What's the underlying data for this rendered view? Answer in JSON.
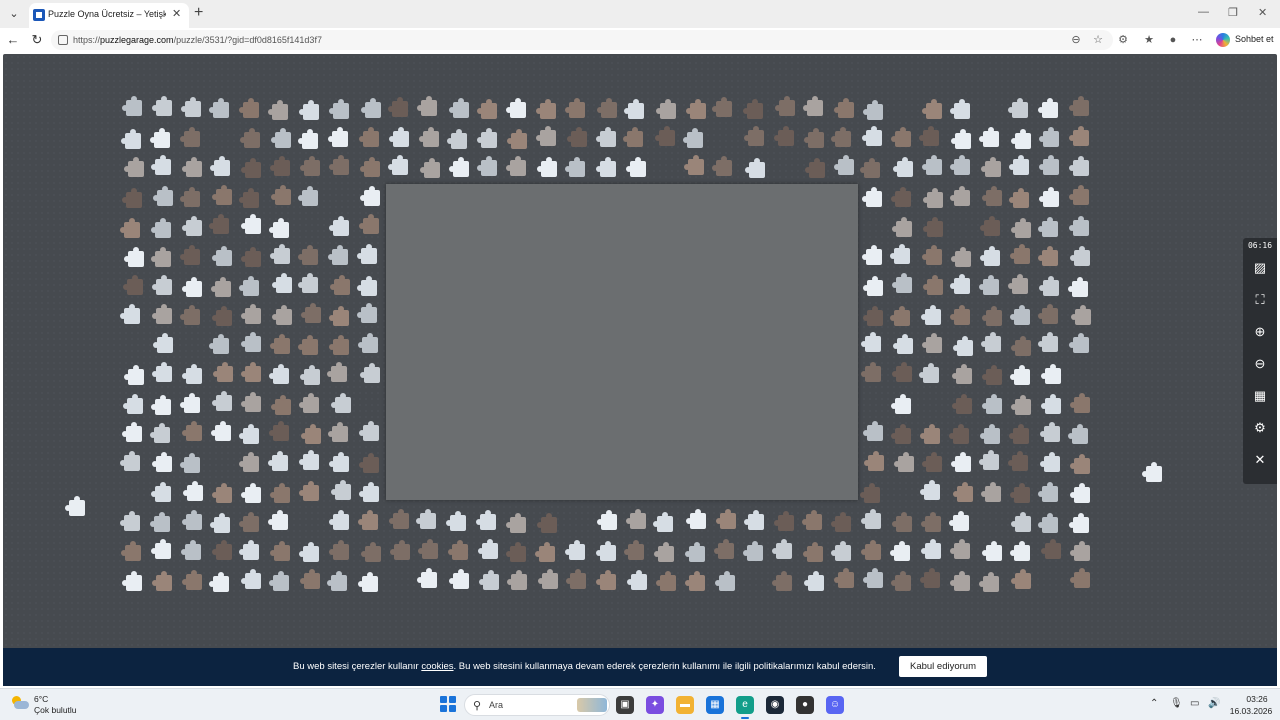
{
  "browser": {
    "tab_title": "Puzzle Oyna Ücretsiz – Yetişkinler",
    "tab_menu_icon": "chevron-down-icon",
    "new_tab_symbol": "+",
    "close_symbol": "✕",
    "url_scheme": "https://",
    "url_host": "puzzlegarage.com",
    "url_path": "/puzzle/3531/?gid=df0d8165f141d3f7",
    "copilot_label": "Sohbet et"
  },
  "game": {
    "timer": "06:16",
    "side_buttons": [
      "image-icon",
      "fullscreen-icon",
      "zoom-in-icon",
      "zoom-out-icon",
      "grid-icon",
      "settings-icon",
      "close-icon"
    ],
    "piece_colors": [
      "#e9eef3",
      "#d6dde4",
      "#b9c0c7",
      "#7d6e66",
      "#8a776c",
      "#9a8579",
      "#6b5d57",
      "#c7cdd3",
      "#a9a3a0"
    ]
  },
  "cookie": {
    "text_before": "Bu web sitesi çerezler kullanır ",
    "link": "cookies",
    "text_after": ". Bu web sitesini kullanmaya devam ederek çerezlerin kullanımı ile ilgili politikalarımızı kabul edersin.",
    "button": "Kabul ediyorum"
  },
  "taskbar": {
    "temperature": "6°C",
    "weather": "Çok bulutlu",
    "search_placeholder": "Ara",
    "time": "03:26",
    "date": "16.03.2026",
    "apps": [
      {
        "name": "task-view-icon",
        "color": "#3c3c3c",
        "glyph": "▣"
      },
      {
        "name": "copilot-app-icon",
        "color": "#7a4de0",
        "glyph": "✦"
      },
      {
        "name": "file-explorer-icon",
        "color": "#f2b233",
        "glyph": "▬"
      },
      {
        "name": "store-icon",
        "color": "#1a73d9",
        "glyph": "▦"
      },
      {
        "name": "edge-icon",
        "color": "#139e8a",
        "glyph": "e"
      },
      {
        "name": "steam-icon",
        "color": "#1b2838",
        "glyph": "◉"
      },
      {
        "name": "app-icon",
        "color": "#333333",
        "glyph": "●"
      },
      {
        "name": "discord-icon",
        "color": "#5865f2",
        "glyph": "☺"
      }
    ]
  }
}
